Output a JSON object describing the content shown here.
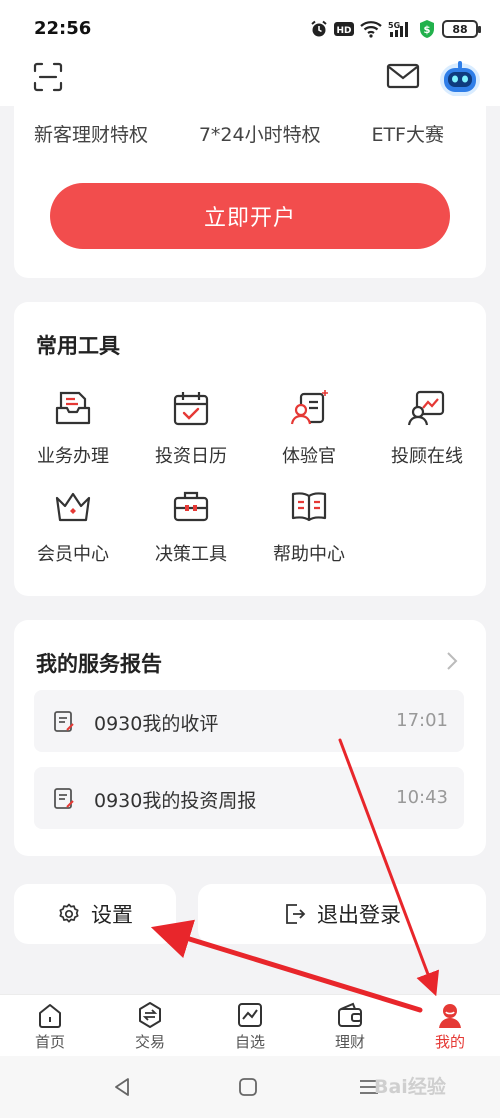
{
  "status_bar": {
    "time": "22:56",
    "battery": "88"
  },
  "account": {
    "privileges": [
      "新客理财特权",
      "7*24小时特权",
      "ETF大赛"
    ],
    "open_button": "立即开户"
  },
  "tools": {
    "title": "常用工具",
    "items": [
      {
        "label": "业务办理",
        "icon": "business-icon"
      },
      {
        "label": "投资日历",
        "icon": "calendar-icon"
      },
      {
        "label": "体验官",
        "icon": "experience-officer-icon"
      },
      {
        "label": "投顾在线",
        "icon": "advisor-online-icon"
      },
      {
        "label": "会员中心",
        "icon": "crown-icon"
      },
      {
        "label": "决策工具",
        "icon": "toolbox-icon"
      },
      {
        "label": "帮助中心",
        "icon": "book-icon"
      }
    ]
  },
  "reports": {
    "title": "我的服务报告",
    "items": [
      {
        "title": "0930我的收评",
        "time": "17:01"
      },
      {
        "title": "0930我的投资周报",
        "time": "10:43"
      }
    ]
  },
  "settings_label": "设置",
  "logout_label": "退出登录",
  "tabs": [
    {
      "label": "首页",
      "icon": "home-icon",
      "active": false
    },
    {
      "label": "交易",
      "icon": "trade-icon",
      "active": false
    },
    {
      "label": "自选",
      "icon": "watchlist-icon",
      "active": false
    },
    {
      "label": "理财",
      "icon": "wallet-icon",
      "active": false
    },
    {
      "label": "我的",
      "icon": "profile-icon",
      "active": true
    }
  ],
  "colors": {
    "accent": "#f24d4d",
    "annotation_arrow": "#e8262b"
  },
  "watermark": "Bai经验"
}
